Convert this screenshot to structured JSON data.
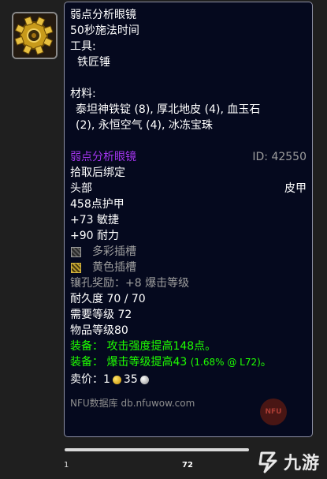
{
  "item": {
    "name": "弱点分析眼镜",
    "cast_time": "50秒施法时间",
    "tools_label": "工具:",
    "tool_name": "铁匠锤",
    "materials_label": "材料:",
    "materials_line1": "泰坦神铁锭 (8), 厚北地皮 (4), 血玉石",
    "materials_line2": "(2), 永恒空气 (4), 冰冻宝珠"
  },
  "stats": {
    "name": "弱点分析眼镜",
    "id_label": "ID: 42550",
    "bind": "拾取后绑定",
    "slot": "头部",
    "armor_type": "皮甲",
    "armor": "458点护甲",
    "agility": "+73 敏捷",
    "stamina": "+90 耐力",
    "socket_prismatic": "多彩插槽",
    "socket_yellow": "黄色插槽",
    "socket_bonus": "镶孔奖励：+8 爆击等级",
    "durability": "耐久度 70 / 70",
    "req_level": "需要等级 72",
    "item_level": "物品等级80",
    "equip1": "装备：  攻击强度提高148点。",
    "equip2_main": "装备：  爆击等级提高43",
    "equip2_small": "(1.68% @ L72)",
    "equip2_end": "。",
    "sell_label": "卖价：1",
    "sell_silver": "35",
    "source": "NFU数据库 db.nfuwow.com",
    "badge": "NFU"
  },
  "pagination": {
    "left": "1",
    "right": "72"
  },
  "watermark": {
    "text": "九游"
  },
  "colors": {
    "epic": "#a335ee",
    "poor": "#9d9d9d",
    "uncommon": "#1eff00",
    "tooltip_bg": "#05091e"
  },
  "icons": [
    "gear-goggles-icon",
    "prismatic-socket-icon",
    "yellow-socket-icon",
    "gold-coin-icon",
    "silver-coin-icon",
    "ninegame-logo-icon"
  ]
}
